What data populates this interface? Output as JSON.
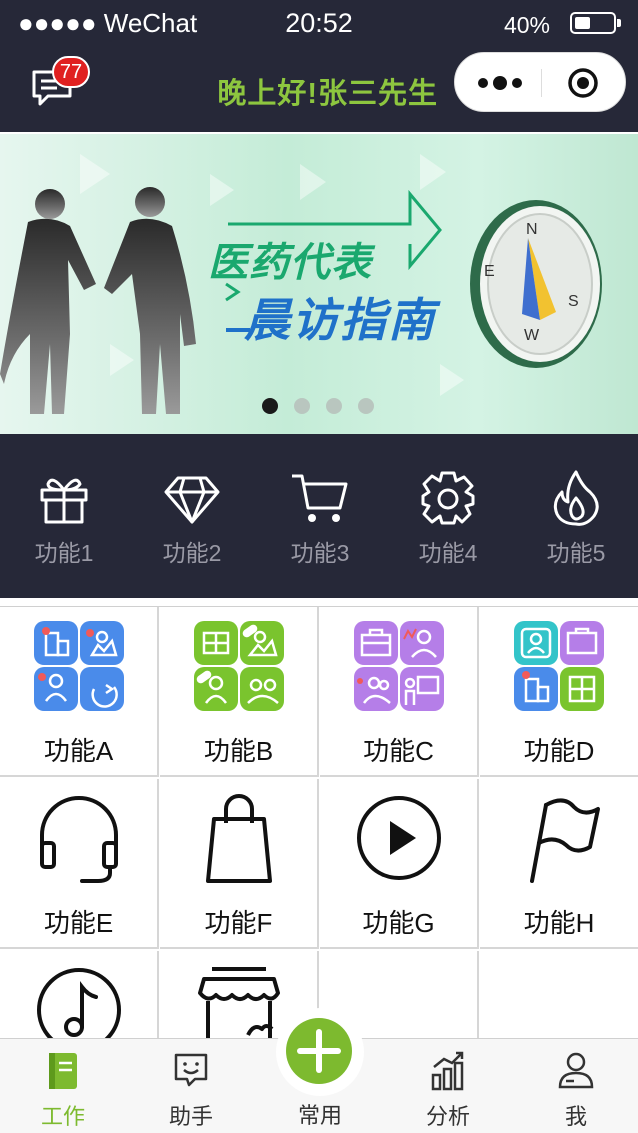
{
  "status_bar": {
    "carrier": "●●●●● WeChat",
    "time": "20:52",
    "battery_percent": "40%",
    "battery_level": 0.4
  },
  "header": {
    "messages_badge": "77",
    "greeting": "晚上好!张三先生",
    "capsule_more_icon": "more-dots-icon",
    "capsule_close_icon": "target-icon"
  },
  "banner": {
    "title_line1": "医药代表",
    "title_line2": "晨访指南",
    "compass_letters": [
      "N",
      "E",
      "S",
      "W"
    ],
    "slide_count": 4,
    "active_slide": 1
  },
  "features": [
    {
      "label": "功能1",
      "icon": "gift-icon"
    },
    {
      "label": "功能2",
      "icon": "diamond-icon"
    },
    {
      "label": "功能3",
      "icon": "cart-icon"
    },
    {
      "label": "功能4",
      "icon": "settings-gear-icon"
    },
    {
      "label": "功能5",
      "icon": "flame-icon"
    }
  ],
  "grid": [
    {
      "label": "功能A",
      "icon": "office-tiles-blue-icon"
    },
    {
      "label": "功能B",
      "icon": "office-tiles-green-icon"
    },
    {
      "label": "功能C",
      "icon": "office-tiles-purple-icon"
    },
    {
      "label": "功能D",
      "icon": "office-tiles-mixed-icon"
    },
    {
      "label": "功能E",
      "icon": "headset-icon"
    },
    {
      "label": "功能F",
      "icon": "shopping-bag-icon"
    },
    {
      "label": "功能G",
      "icon": "play-circle-icon"
    },
    {
      "label": "功能H",
      "icon": "flag-icon"
    },
    {
      "label": "",
      "icon": "music-note-icon"
    },
    {
      "label": "",
      "icon": "store-icon"
    },
    {
      "label": "",
      "icon": ""
    },
    {
      "label": "",
      "icon": ""
    }
  ],
  "tabs": [
    {
      "label": "工作",
      "icon": "book-icon",
      "active": true
    },
    {
      "label": "助手",
      "icon": "chat-smile-icon",
      "active": false
    },
    {
      "label": "常用",
      "icon": "plus-icon",
      "active": false
    },
    {
      "label": "分析",
      "icon": "bar-chart-icon",
      "active": false
    },
    {
      "label": "我",
      "icon": "user-icon",
      "active": false
    }
  ],
  "colors": {
    "header_bg": "#262838",
    "accent_green": "#7dba2f",
    "greeting_green": "#8dc63f",
    "badge_red": "#e02020"
  }
}
